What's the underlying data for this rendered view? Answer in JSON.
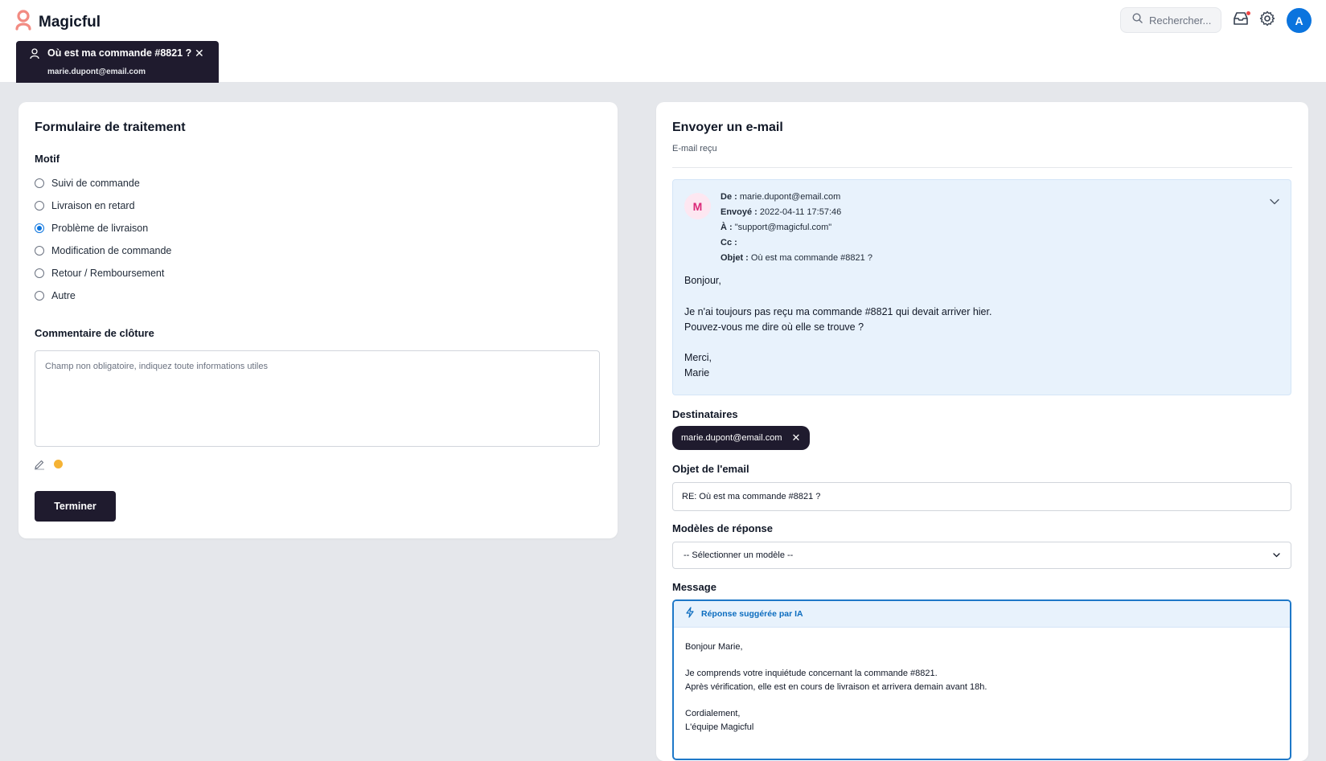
{
  "app": {
    "name": "Magicful"
  },
  "header": {
    "search_placeholder": "Rechercher...",
    "avatar_initial": "A"
  },
  "ticket_tab": {
    "title": "Où est ma commande #8821 ?",
    "email": "marie.dupont@email.com",
    "close": "✕"
  },
  "form": {
    "title": "Formulaire de traitement",
    "motif_label": "Motif",
    "options": [
      {
        "label": "Suivi de commande",
        "checked": false
      },
      {
        "label": "Livraison en retard",
        "checked": false
      },
      {
        "label": "Problème de livraison",
        "checked": true
      },
      {
        "label": "Modification de commande",
        "checked": false
      },
      {
        "label": "Retour / Remboursement",
        "checked": false
      },
      {
        "label": "Autre",
        "checked": false
      }
    ],
    "comment_label": "Commentaire de clôture",
    "comment_placeholder": "Champ non obligatoire, indiquez toute informations utiles",
    "status_color": "#f5b335",
    "submit_label": "Terminer"
  },
  "email": {
    "title": "Envoyer un e-mail",
    "received_label": "E-mail reçu",
    "sender_initial": "M",
    "meta": {
      "from_key": "De :",
      "from": "marie.dupont@email.com",
      "sent_key": "Envoyé :",
      "sent": "2022-04-11 17:57:46",
      "to_key": "À :",
      "to": "\"support@magicful.com\"",
      "cc_key": "Cc :",
      "cc": "",
      "subject_key": "Objet :",
      "subject": "Où est ma commande #8821 ?"
    },
    "body": [
      "Bonjour,",
      "Je n'ai toujours pas reçu ma commande #8821 qui devait arriver hier.",
      "Pouvez-vous me dire où elle se trouve ?",
      "Merci,",
      "Marie"
    ],
    "recipients_label": "Destinataires",
    "recipient": "marie.dupont@email.com",
    "recipient_remove": "✕",
    "subject_label": "Objet de l'email",
    "subject_value": "RE: Où est ma commande #8821 ?",
    "templates_label": "Modèles de réponse",
    "templates_selected": "-- Sélectionner un modèle --",
    "message_label": "Message",
    "ai_label": "Réponse suggérée par IA",
    "message_lines": [
      "Bonjour Marie,",
      "Je comprends votre inquiétude concernant la commande #8821.",
      "Après vérification, elle est en cours de livraison et arrivera demain avant 18h.",
      "Cordialement,",
      "L'équipe Magicful"
    ]
  },
  "colors": {
    "dark": "#1f1b2e",
    "accent": "#0b74de",
    "ai_blue": "#0b6cbf",
    "brand_logo": "#f28b82"
  }
}
